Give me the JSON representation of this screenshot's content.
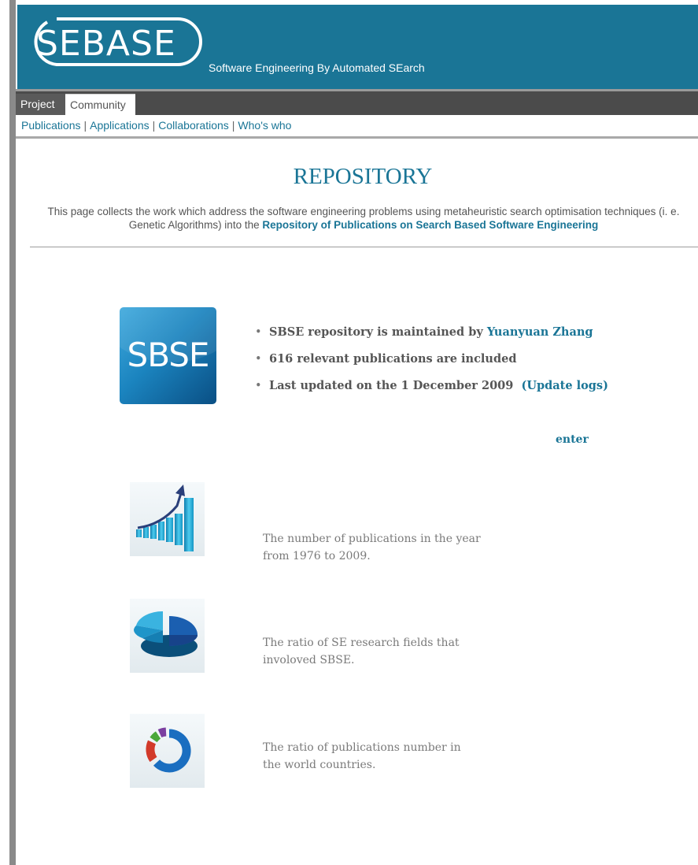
{
  "header": {
    "logo_text": "SEBASE",
    "tagline": "Software Engineering By Automated SEarch"
  },
  "tabs": [
    {
      "label": "Project",
      "active": false
    },
    {
      "label": "Community",
      "active": true
    }
  ],
  "subnav": [
    {
      "label": "Publications"
    },
    {
      "label": "Applications"
    },
    {
      "label": "Collaborations"
    },
    {
      "label": "Who's who"
    }
  ],
  "subnav_separator": "|",
  "page": {
    "title": "REPOSITORY",
    "intro_text": "This page collects the work which address the software engineering problems using metaheuristic search optimisation techniques (i. e. Genetic Algorithms) into the",
    "intro_link": "Repository of Publications on Search Based Software Engineering"
  },
  "repository": {
    "badge_text": "SBSE",
    "maintained_text": "SBSE repository is maintained by",
    "maintainer": "Yuanyuan Zhang",
    "publications_text": "616 relevant publications are included",
    "updated_text": "Last updated on the 1 December 2009",
    "update_logs": "(Update logs)",
    "enter_label": "enter"
  },
  "stats": [
    {
      "icon": "bar-chart-icon",
      "text_line1": "The number of publications in the year",
      "text_line2": "from 1976 to 2009."
    },
    {
      "icon": "pie-chart-icon",
      "text_line1": "The ratio of SE research fields that",
      "text_line2": "involoved SBSE."
    },
    {
      "icon": "ring-chart-icon",
      "text_line1": "The ratio of publications number in",
      "text_line2": "the world countries."
    }
  ],
  "colors": {
    "brand": "#1a7596",
    "tab_bar": "#4b4b4b",
    "text_gray": "#555555"
  }
}
